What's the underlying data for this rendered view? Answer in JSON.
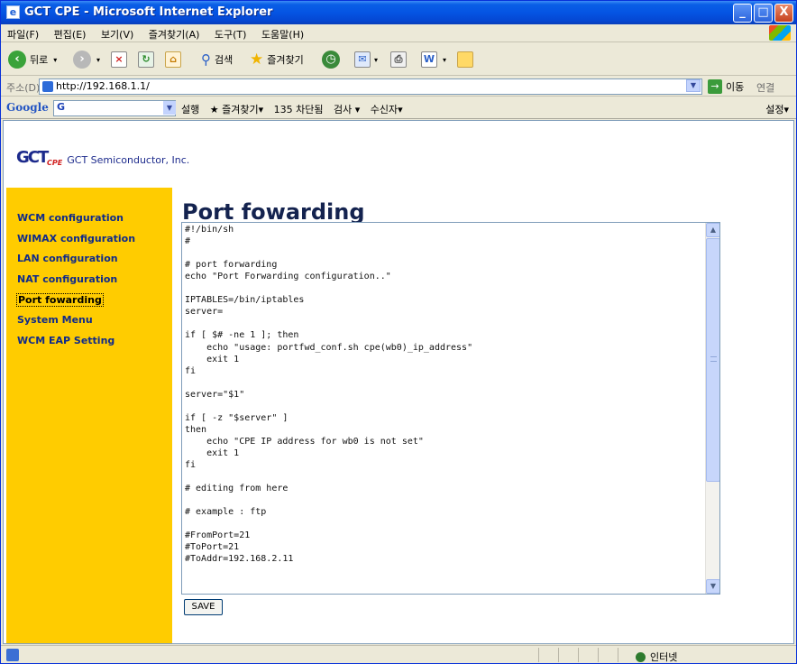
{
  "window": {
    "title": "GCT CPE - Microsoft Internet Explorer",
    "minimize": "_",
    "maximize": "□",
    "close": "X"
  },
  "menu": [
    "파일(F)",
    "편집(E)",
    "보기(V)",
    "즐겨찾기(A)",
    "도구(T)",
    "도움말(H)"
  ],
  "toolbar": {
    "back": "뒤로",
    "search": "검색",
    "favorites": "즐겨찾기"
  },
  "address": {
    "label": "주소(D)",
    "url": "http://192.168.1.1/",
    "go": "이동",
    "links": "연결"
  },
  "google": {
    "brand": "Google",
    "search_value": "G",
    "items": [
      "설행",
      "★ 즐겨찾기▾",
      "135 차단됨",
      "검사 ▾",
      "수신자▾"
    ],
    "settings": "설정▾"
  },
  "page": {
    "company": "GCT Semiconductor, Inc.",
    "logo": "GCT",
    "logo_sub": "CPE",
    "title": "Port fowarding",
    "nav": [
      {
        "label": "WCM configuration",
        "active": false
      },
      {
        "label": "WIMAX configuration",
        "active": false
      },
      {
        "label": "LAN configuration",
        "active": false
      },
      {
        "label": "NAT configuration",
        "active": false
      },
      {
        "label": "Port fowarding",
        "active": true
      },
      {
        "label": "System Menu",
        "active": false
      },
      {
        "label": "WCM EAP Setting",
        "active": false
      }
    ],
    "script_lines": [
      "#!/bin/sh",
      "#",
      "",
      "# port forwarding",
      "echo \"Port Forwarding configuration..\"",
      "",
      "IPTABLES=/bin/iptables",
      "server=",
      "",
      "if [ $# -ne 1 ]; then",
      "    echo \"usage: portfwd_conf.sh cpe(wb0)_ip_address\"",
      "    exit 1",
      "fi",
      "",
      "server=\"$1\"",
      "",
      "if [ -z \"$server\" ]",
      "then",
      "    echo \"CPE IP address for wb0 is not set\"",
      "    exit 1",
      "fi",
      "",
      "# editing from here",
      "",
      "# example : ftp",
      "",
      "#FromPort=21",
      "#ToPort=21",
      "#ToAddr=192.168.2.11"
    ],
    "save_label": "SAVE"
  },
  "status": {
    "zone": "인터넷"
  }
}
